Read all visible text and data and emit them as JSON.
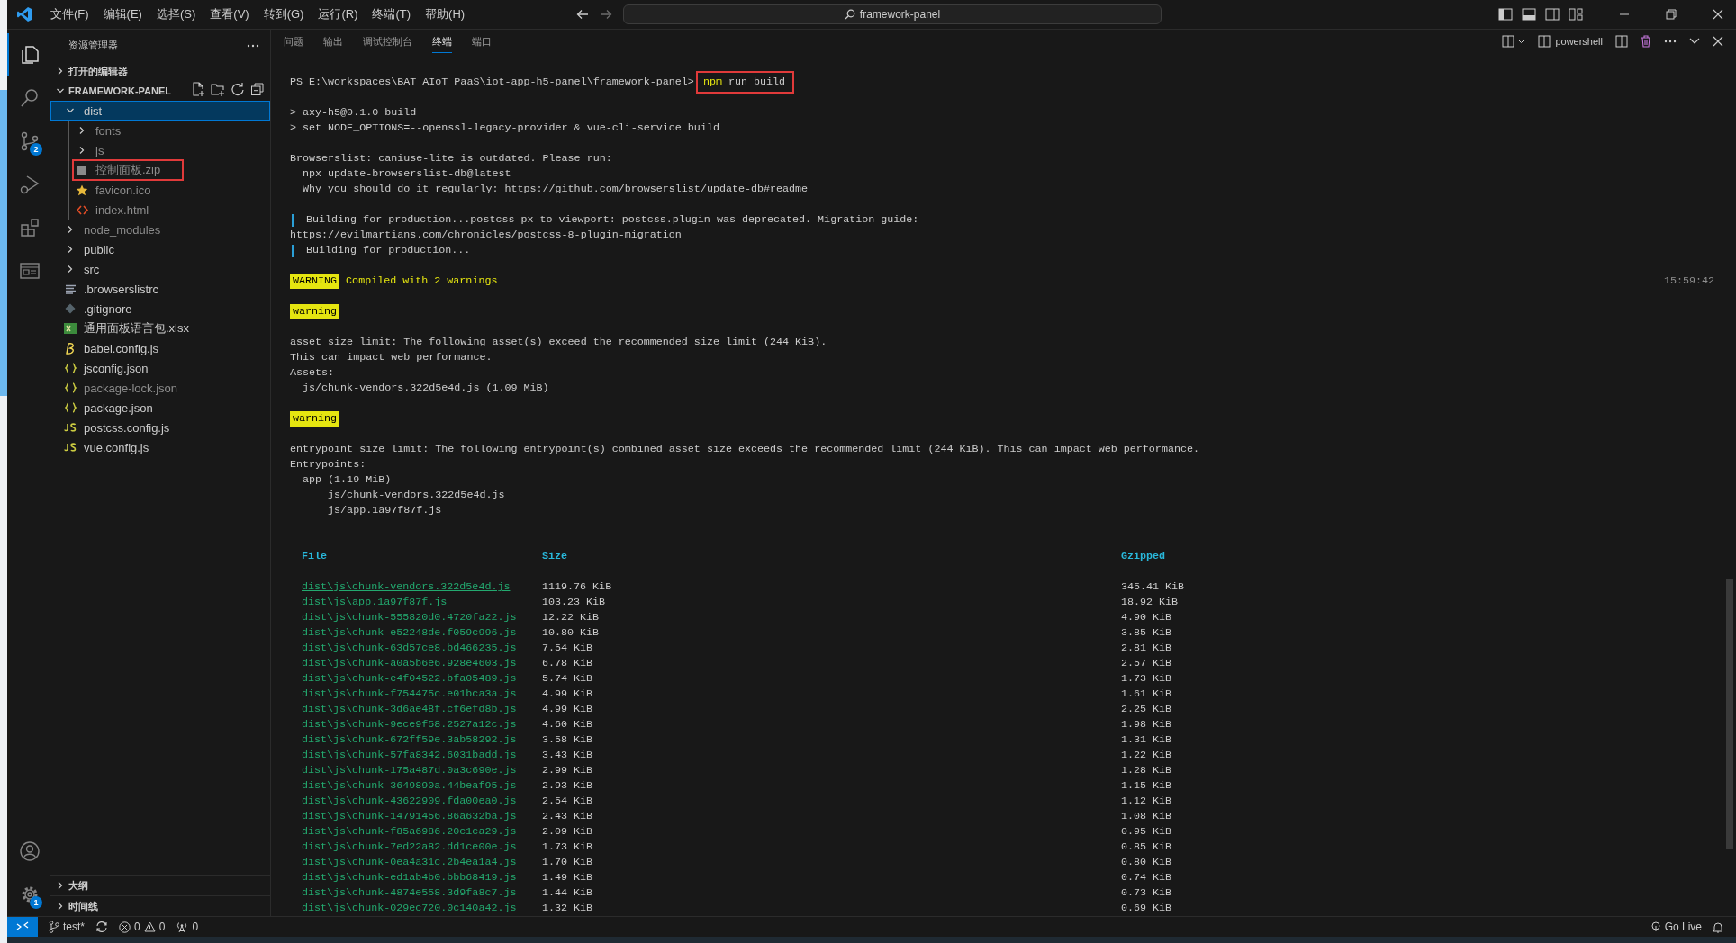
{
  "title_bar": {
    "menus": [
      "文件(F)",
      "编辑(E)",
      "选择(S)",
      "查看(V)",
      "转到(G)",
      "运行(R)",
      "终端(T)",
      "帮助(H)"
    ],
    "search": "framework-panel"
  },
  "activity_bar": {
    "items": [
      {
        "kind": "files",
        "selected": true
      },
      {
        "kind": "search",
        "selected": false
      },
      {
        "kind": "source-control",
        "selected": false,
        "badge": "2"
      },
      {
        "kind": "run",
        "selected": false
      },
      {
        "kind": "extensions",
        "selected": false
      },
      {
        "kind": "preview",
        "selected": false
      }
    ],
    "bottom": [
      {
        "kind": "account"
      },
      {
        "kind": "settings",
        "badge": "1"
      }
    ]
  },
  "explorer": {
    "title": "资源管理器",
    "open_editors": {
      "title": "打开的编辑器",
      "expanded": false
    },
    "folder": {
      "title": "FRAMEWORK-PANEL",
      "expanded": true
    },
    "tree": [
      {
        "name": "dist",
        "kind": "folder",
        "expanded": true,
        "selected": true,
        "ignored": false,
        "annotated": false,
        "children": [
          {
            "name": "fonts",
            "kind": "folder",
            "expanded": false,
            "selected": false,
            "ignored": true,
            "annotated": false
          },
          {
            "name": "js",
            "kind": "folder",
            "expanded": false,
            "selected": false,
            "ignored": true,
            "annotated": false
          },
          {
            "name": "控制面板.zip",
            "kind": "zip",
            "selected": false,
            "ignored": true,
            "annotated": true
          },
          {
            "name": "favicon.ico",
            "kind": "star",
            "selected": false,
            "ignored": true,
            "annotated": false
          },
          {
            "name": "index.html",
            "kind": "html",
            "selected": false,
            "ignored": true,
            "annotated": false
          }
        ]
      },
      {
        "name": "node_modules",
        "kind": "folder",
        "expanded": false,
        "selected": false,
        "ignored": true,
        "annotated": false
      },
      {
        "name": "public",
        "kind": "folder",
        "expanded": false,
        "selected": false,
        "ignored": false,
        "annotated": false
      },
      {
        "name": "src",
        "kind": "folder",
        "expanded": false,
        "selected": false,
        "ignored": false,
        "annotated": false
      },
      {
        "name": ".browserslistrc",
        "kind": "lines",
        "selected": false,
        "ignored": false,
        "annotated": false
      },
      {
        "name": ".gitignore",
        "kind": "git",
        "selected": false,
        "ignored": false,
        "annotated": false
      },
      {
        "name": "通用面板语言包.xlsx",
        "kind": "excel",
        "selected": false,
        "ignored": false,
        "annotated": false
      },
      {
        "name": "babel.config.js",
        "kind": "babel",
        "selected": false,
        "ignored": false,
        "annotated": false
      },
      {
        "name": "jsconfig.json",
        "kind": "json",
        "selected": false,
        "ignored": false,
        "annotated": false
      },
      {
        "name": "package-lock.json",
        "kind": "json",
        "selected": false,
        "ignored": true,
        "annotated": false
      },
      {
        "name": "package.json",
        "kind": "json",
        "selected": false,
        "ignored": false,
        "annotated": false
      },
      {
        "name": "postcss.config.js",
        "kind": "js",
        "selected": false,
        "ignored": false,
        "annotated": false
      },
      {
        "name": "vue.config.js",
        "kind": "js",
        "selected": false,
        "ignored": false,
        "annotated": false
      }
    ],
    "bottom_sections": [
      {
        "title": "大纲",
        "expanded": false
      },
      {
        "title": "时间线",
        "expanded": false
      }
    ]
  },
  "panel": {
    "tabs": [
      {
        "label": "问题",
        "selected": false
      },
      {
        "label": "输出",
        "selected": false
      },
      {
        "label": "调试控制台",
        "selected": false
      },
      {
        "label": "终端",
        "selected": true
      },
      {
        "label": "端口",
        "selected": false
      }
    ],
    "terminal_name": "powershell"
  },
  "terminal": {
    "lines": [
      {
        "kind": "prompt",
        "path": "PS E:\\workspaces\\BAT_AIoT_PaaS\\iot-app-h5-panel\\framework-panel>",
        "program": "npm",
        "args": " run build",
        "annotated": true
      },
      {
        "kind": "blank"
      },
      {
        "kind": "plain",
        "text": "> axy-h5@0.1.0 build"
      },
      {
        "kind": "plain",
        "text": "> set NODE_OPTIONS=--openssl-legacy-provider & vue-cli-service build"
      },
      {
        "kind": "blank"
      },
      {
        "kind": "plain",
        "text": "Browserslist: caniuse-lite is outdated. Please run:"
      },
      {
        "kind": "plain",
        "text": "  npx update-browserslist-db@latest"
      },
      {
        "kind": "plain",
        "text": "  Why you should do it regularly: https://github.com/browserslist/update-db#readme"
      },
      {
        "kind": "blank"
      },
      {
        "kind": "progress",
        "text": "Building for production...postcss-px-to-viewport: postcss.plugin was deprecated. Migration guide:"
      },
      {
        "kind": "plain",
        "text": "https://evilmartians.com/chronicles/postcss-8-plugin-migration"
      },
      {
        "kind": "progress",
        "text": "Building for production..."
      },
      {
        "kind": "blank"
      },
      {
        "kind": "badge",
        "badge": "WARNING",
        "text": "Compiled with 2 warnings",
        "timestamp": "15:59:42"
      },
      {
        "kind": "blank"
      },
      {
        "kind": "badge",
        "badge": "warning"
      },
      {
        "kind": "blank"
      },
      {
        "kind": "plain",
        "text": "asset size limit: The following asset(s) exceed the recommended size limit (244 KiB)."
      },
      {
        "kind": "plain",
        "text": "This can impact web performance."
      },
      {
        "kind": "plain",
        "text": "Assets:"
      },
      {
        "kind": "plain",
        "text": "  js/chunk-vendors.322d5e4d.js (1.09 MiB)"
      },
      {
        "kind": "blank"
      },
      {
        "kind": "badge",
        "badge": "warning"
      },
      {
        "kind": "blank"
      },
      {
        "kind": "plain",
        "text": "entrypoint size limit: The following entrypoint(s) combined asset size exceeds the recommended limit (244 KiB). This can impact web performance."
      },
      {
        "kind": "plain",
        "text": "Entrypoints:"
      },
      {
        "kind": "plain",
        "text": "  app (1.19 MiB)"
      },
      {
        "kind": "plain",
        "text": "      js/chunk-vendors.322d5e4d.js"
      },
      {
        "kind": "plain",
        "text": "      js/app.1a97f87f.js"
      },
      {
        "kind": "blank"
      },
      {
        "kind": "blank"
      }
    ],
    "table": {
      "columns": [
        "File",
        "Size",
        "Gzipped"
      ],
      "rows": [
        {
          "file": "dist\\js\\chunk-vendors.322d5e4d.js",
          "size": "1119.76 KiB",
          "gzipped": "345.41 KiB",
          "hovered": true
        },
        {
          "file": "dist\\js\\app.1a97f87f.js",
          "size": "103.23 KiB",
          "gzipped": "18.92 KiB",
          "hovered": false
        },
        {
          "file": "dist\\js\\chunk-555820d0.4720fa22.js",
          "size": "12.22 KiB",
          "gzipped": "4.90 KiB",
          "hovered": false
        },
        {
          "file": "dist\\js\\chunk-e52248de.f059c996.js",
          "size": "10.80 KiB",
          "gzipped": "3.85 KiB",
          "hovered": false
        },
        {
          "file": "dist\\js\\chunk-63d57ce8.bd466235.js",
          "size": "7.54 KiB",
          "gzipped": "2.81 KiB",
          "hovered": false
        },
        {
          "file": "dist\\js\\chunk-a0a5b6e6.928e4603.js",
          "size": "6.78 KiB",
          "gzipped": "2.57 KiB",
          "hovered": false
        },
        {
          "file": "dist\\js\\chunk-e4f04522.bfa05489.js",
          "size": "5.74 KiB",
          "gzipped": "1.73 KiB",
          "hovered": false
        },
        {
          "file": "dist\\js\\chunk-f754475c.e01bca3a.js",
          "size": "4.99 KiB",
          "gzipped": "1.61 KiB",
          "hovered": false
        },
        {
          "file": "dist\\js\\chunk-3d6ae48f.cf6efd8b.js",
          "size": "4.99 KiB",
          "gzipped": "2.25 KiB",
          "hovered": false
        },
        {
          "file": "dist\\js\\chunk-9ece9f58.2527a12c.js",
          "size": "4.60 KiB",
          "gzipped": "1.98 KiB",
          "hovered": false
        },
        {
          "file": "dist\\js\\chunk-672ff59e.3ab58292.js",
          "size": "3.58 KiB",
          "gzipped": "1.31 KiB",
          "hovered": false
        },
        {
          "file": "dist\\js\\chunk-57fa8342.6031badd.js",
          "size": "3.43 KiB",
          "gzipped": "1.22 KiB",
          "hovered": false
        },
        {
          "file": "dist\\js\\chunk-175a487d.0a3c690e.js",
          "size": "2.99 KiB",
          "gzipped": "1.28 KiB",
          "hovered": false
        },
        {
          "file": "dist\\js\\chunk-3649890a.44beaf95.js",
          "size": "2.93 KiB",
          "gzipped": "1.15 KiB",
          "hovered": false
        },
        {
          "file": "dist\\js\\chunk-43622909.fda00ea0.js",
          "size": "2.54 KiB",
          "gzipped": "1.12 KiB",
          "hovered": false
        },
        {
          "file": "dist\\js\\chunk-14791456.86a632ba.js",
          "size": "2.43 KiB",
          "gzipped": "1.08 KiB",
          "hovered": false
        },
        {
          "file": "dist\\js\\chunk-f85a6986.20c1ca29.js",
          "size": "2.09 KiB",
          "gzipped": "0.95 KiB",
          "hovered": false
        },
        {
          "file": "dist\\js\\chunk-7ed22a82.dd1ce00e.js",
          "size": "1.73 KiB",
          "gzipped": "0.85 KiB",
          "hovered": false
        },
        {
          "file": "dist\\js\\chunk-0ea4a31c.2b4ea1a4.js",
          "size": "1.70 KiB",
          "gzipped": "0.80 KiB",
          "hovered": false
        },
        {
          "file": "dist\\js\\chunk-ed1ab4b0.bbb68419.js",
          "size": "1.49 KiB",
          "gzipped": "0.74 KiB",
          "hovered": false
        },
        {
          "file": "dist\\js\\chunk-4874e558.3d9fa8c7.js",
          "size": "1.44 KiB",
          "gzipped": "0.73 KiB",
          "hovered": false
        },
        {
          "file": "dist\\js\\chunk-029ec720.0c140a42.js",
          "size": "1.32 KiB",
          "gzipped": "0.69 KiB",
          "hovered": false
        }
      ]
    }
  },
  "status_bar": {
    "branch": "test*",
    "errors": "0",
    "warnings": "0",
    "ports": "0",
    "go_live": "Go Live"
  }
}
